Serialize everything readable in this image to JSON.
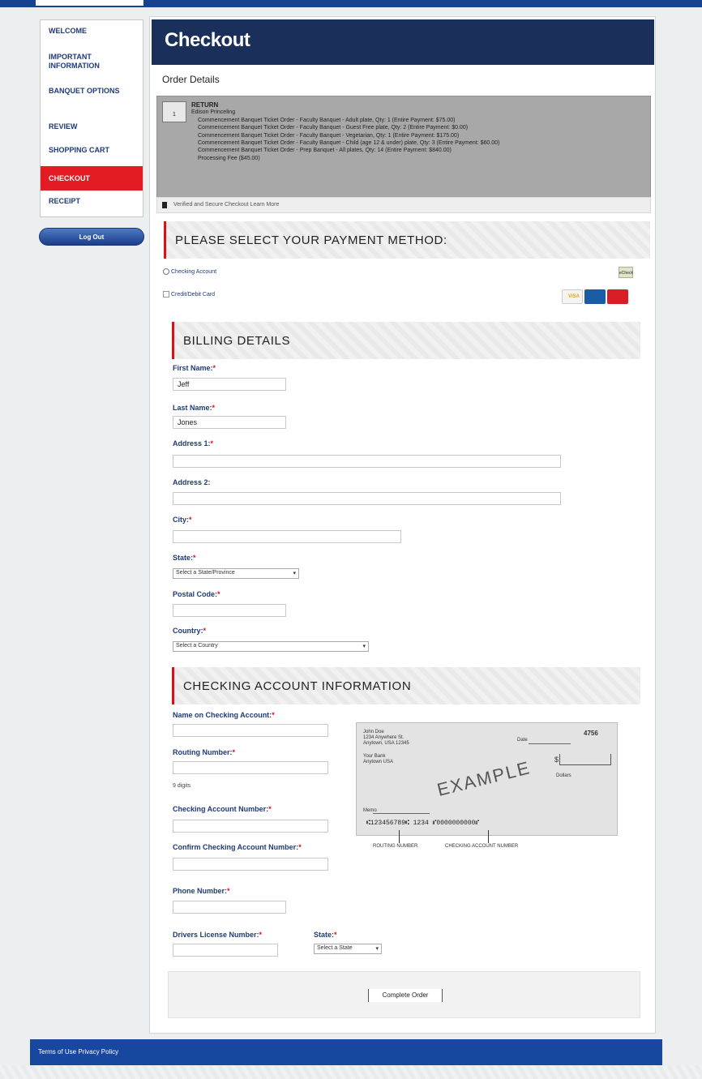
{
  "sidebar": {
    "items": [
      {
        "label": "WELCOME"
      },
      {
        "label": "IMPORTANT INFORMATION"
      },
      {
        "label": "BANQUET OPTIONS"
      },
      {
        "label": "REVIEW"
      },
      {
        "label": "SHOPPING CART"
      },
      {
        "label": "CHECKOUT",
        "active": true
      },
      {
        "label": "RECEIPT"
      }
    ],
    "logout_label": "Log Out"
  },
  "header": {
    "title": "Checkout"
  },
  "order": {
    "title": "Order Details",
    "icon_label": "1",
    "summary_title": "RETURN",
    "summary_sub": "Edison Princeling",
    "lines": [
      "Commencement Banquet Ticket Order - Faculty Banquet - Adult plate, Qty: 1 (Entire Payment: $75.00)",
      "Commencement Banquet Ticket Order - Faculty Banquet - Guest Free plate, Qty: 2 (Entire Payment: $0.00)",
      "Commencement Banquet Ticket Order - Faculty Banquet - Vegetarian, Qty: 1 (Entire Payment: $175.00)",
      "Commencement Banquet Ticket Order - Faculty Banquet - Child (age 12 & under) plate, Qty: 3 (Entire Payment: $60.00)",
      "Commencement Banquet Ticket Order - Prep Banquet - All plates, Qty: 14 (Entire Payment: $840.00)",
      "Processing Fee ($45.00)"
    ]
  },
  "verified": {
    "text": "Verified and Secure Checkout   Learn More"
  },
  "payment": {
    "heading": "PLEASE SELECT YOUR PAYMENT METHOD:",
    "option_checking": "Checking Account",
    "option_card": "Credit/Debit Card",
    "echeck_label": "eCheck",
    "visa_label": "VISA"
  },
  "billing": {
    "heading": "BILLING DETAILS",
    "first_name_label": "First Name:",
    "first_name_value": "Jeff",
    "last_name_label": "Last Name:",
    "last_name_value": "Jones",
    "address1_label": "Address 1:",
    "address2_label": "Address 2:",
    "city_label": "City:",
    "state_label": "State:",
    "state_value": "Select a State/Province",
    "postal_label": "Postal Code:",
    "country_label": "Country:",
    "country_value": "Select a Country"
  },
  "checking": {
    "heading": "CHECKING ACCOUNT INFORMATION",
    "name_label": "Name on Checking Account:",
    "routing_label": "Routing Number:",
    "routing_hint": "9 digits",
    "account_label": "Checking Account Number:",
    "confirm_label": "Confirm Checking Account Number:",
    "phone_label": "Phone Number:",
    "license_label": "Drivers License Number:",
    "license_state_label": "State:",
    "license_state_value": "Select a State"
  },
  "check_image": {
    "example": "EXAMPLE",
    "check_number": "4756",
    "top_left_1": "John Doe",
    "top_left_2": "1234 Anywhere St.",
    "top_left_3": "Anytown, USA 12345",
    "bank_1": "Your Bank",
    "bank_2": "Anytown USA",
    "date_label": "Date",
    "dollars_label": "Dollars",
    "memo_label": "Memo",
    "micr": "⑆123456789⑆  1234  ⑈0000000000⑈",
    "routing_caption": "ROUTING NUMBER",
    "account_caption": "CHECKING ACCOUNT NUMBER"
  },
  "complete": {
    "label": "Complete Order"
  },
  "footer": {
    "text": "Terms of Use   Privacy Policy"
  }
}
